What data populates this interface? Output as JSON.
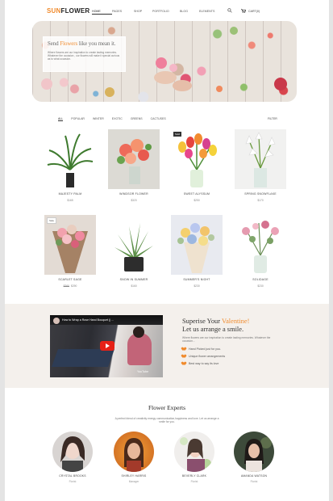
{
  "brand": {
    "part1": "SUN",
    "part2": "FLOWER",
    "accent": "#f08a2c"
  },
  "nav": {
    "items": [
      "HOME",
      "PAGES",
      "SHOP",
      "PORTFOLIO",
      "BLOG",
      "ELEMENTS"
    ],
    "active": "HOME",
    "cart_label": "CART(0)"
  },
  "hero": {
    "title_pre": "Send ",
    "title_highlight": "Flowers",
    "title_post": " like you mean it.",
    "text": "Where flowers are our inspiration to create lasting memories. Whatever the occasion , our flowers will make it special curious as to what occasion."
  },
  "filters": {
    "items": [
      "ALL",
      "POPULAR",
      "WINTER",
      "EXOTIC",
      "GREENS",
      "CACTUSES"
    ],
    "active": "ALL",
    "filter_label": "FILTER"
  },
  "products": [
    {
      "name": "MAJESTY PALM",
      "price": "$165",
      "old_price": "",
      "badge": ""
    },
    {
      "name": "WINDSOR FLOWER",
      "price": "$320",
      "old_price": "",
      "badge": ""
    },
    {
      "name": "SWEET ALYSSUM",
      "price": "$250",
      "old_price": "",
      "badge": "Sold"
    },
    {
      "name": "SPRING SNOWFLAKE",
      "price": "$170",
      "old_price": "",
      "badge": ""
    },
    {
      "name": "SCARLET SAGE",
      "price": "$290",
      "old_price": "$360",
      "badge": "Sale"
    },
    {
      "name": "SNOW IN SUMMER",
      "price": "$160",
      "old_price": "",
      "badge": ""
    },
    {
      "name": "SUMMER'S NIGHT",
      "price": "$230",
      "old_price": "",
      "badge": ""
    },
    {
      "name": "SOLIDAGE",
      "price": "$230",
      "old_price": "",
      "badge": ""
    }
  ],
  "promo": {
    "video_title": "How to Wrap a Rose Hand Bouquet || ...",
    "video_logo": "YouTube",
    "title_pre": "Superise Your ",
    "title_highlight": "Valentine!",
    "title_line2": "Let us arrange a smile.",
    "text": "Where flowers are our inspiration to create lasting memories. Whatever the occasion...",
    "features": [
      "Hand Picked just for you.",
      "Unique flower arrangements",
      "Best way to say its love"
    ]
  },
  "experts": {
    "title": "Flower Experts",
    "subtitle": "A perfect blend of creativity energy communication,happiness and love. Let us arrange a smile for you.",
    "people": [
      {
        "name": "CRYSTAL BROOKS",
        "role": "Florist"
      },
      {
        "name": "SHIRLEY HARRIS",
        "role": "Manager"
      },
      {
        "name": "BEVERLY CLARK",
        "role": "Florist"
      },
      {
        "name": "AMANDA WATSON",
        "role": "Florist"
      }
    ]
  }
}
